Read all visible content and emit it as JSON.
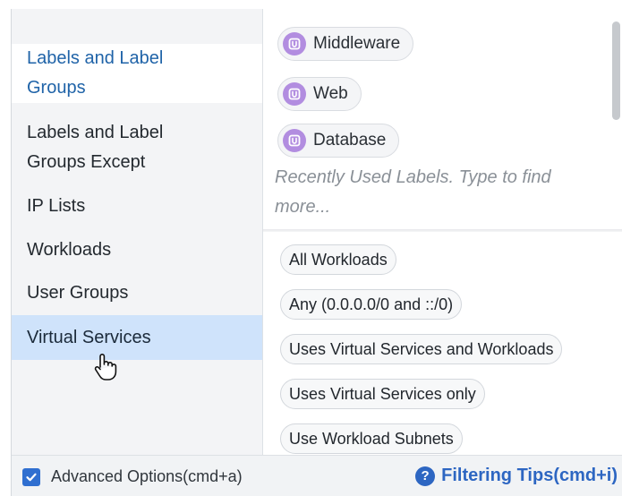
{
  "categories": [
    {
      "label": "Labels and Label Groups",
      "state": "active"
    },
    {
      "label": "Labels and Label Groups Except",
      "state": "normal"
    },
    {
      "label": "IP Lists",
      "state": "normal"
    },
    {
      "label": "Workloads",
      "state": "normal"
    },
    {
      "label": "User Groups",
      "state": "normal"
    },
    {
      "label": "Virtual Services",
      "state": "hovered"
    }
  ],
  "labels": [
    {
      "text": "Middleware",
      "icon": "label-tag-icon"
    },
    {
      "text": "Web",
      "icon": "label-tag-icon"
    },
    {
      "text": "Database",
      "icon": "label-tag-icon"
    }
  ],
  "labels_hint": "Recently Used Labels. Type to find more...",
  "options": [
    "All Workloads",
    "Any (0.0.0.0/0 and ::/0)",
    "Uses Virtual Services and Workloads",
    "Uses Virtual Services only",
    "Use Workload Subnets"
  ],
  "footer": {
    "advanced_label": "Advanced Options(cmd+a)",
    "advanced_checked": true,
    "tips_label": "Filtering Tips(cmd+i)"
  },
  "colors": {
    "accent": "#2d66c2",
    "active_category_text": "#1f63a8",
    "hover_row": "#cfe3fb",
    "label_icon": "#b28de0",
    "checkbox": "#2f6fd0"
  }
}
